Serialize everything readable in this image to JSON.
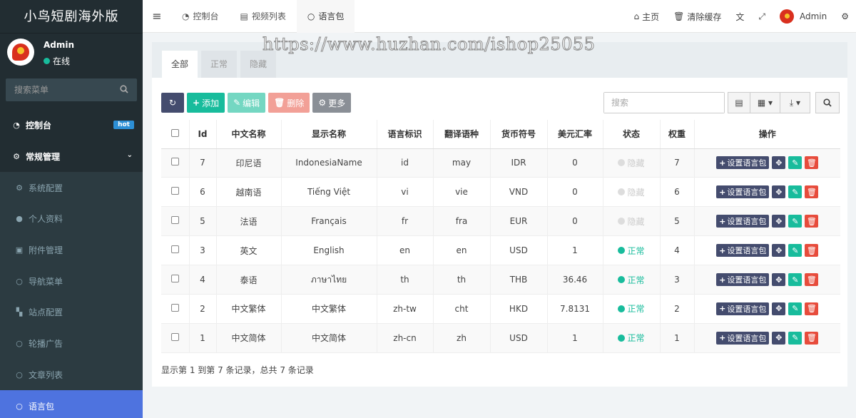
{
  "brand": "小鸟短剧海外版",
  "user": {
    "name": "Admin",
    "status": "在线"
  },
  "sidebar": {
    "search_placeholder": "搜索菜单",
    "items": [
      {
        "label": "控制台",
        "icon": "dashboard-icon",
        "badge": "hot"
      },
      {
        "label": "常规管理",
        "icon": "cogs-icon"
      },
      {
        "label": "系统配置",
        "icon": "gear-icon"
      },
      {
        "label": "个人资料",
        "icon": "user-icon"
      },
      {
        "label": "附件管理",
        "icon": "image-icon"
      },
      {
        "label": "导航菜单",
        "icon": "circle-icon"
      },
      {
        "label": "站点配置",
        "icon": "cubes-icon"
      },
      {
        "label": "轮播广告",
        "icon": "circle-icon"
      },
      {
        "label": "文章列表",
        "icon": "circle-icon"
      },
      {
        "label": "语言包",
        "icon": "circle-icon"
      }
    ]
  },
  "topnav": {
    "tabs": [
      {
        "label": "控制台",
        "icon": "dashboard-icon"
      },
      {
        "label": "视频列表",
        "icon": "file-icon"
      },
      {
        "label": "语言包",
        "icon": "circle-icon"
      }
    ],
    "home_label": "主页",
    "clear_cache_label": "清除缓存",
    "admin_label": "Admin"
  },
  "watermark": "https://www.huzhan.com/ishop25055",
  "filter_tabs": [
    "全部",
    "正常",
    "隐藏"
  ],
  "toolbar": {
    "add_label": "添加",
    "edit_label": "编辑",
    "delete_label": "删除",
    "more_label": "更多",
    "search_placeholder": "搜索"
  },
  "table": {
    "headers": [
      "Id",
      "中文名称",
      "显示名称",
      "语言标识",
      "翻译语种",
      "货币符号",
      "美元汇率",
      "状态",
      "权重",
      "操作"
    ],
    "rows": [
      {
        "id": "7",
        "cn_name": "印尼语",
        "display_name": "IndonesiaName",
        "lang": "id",
        "trans": "may",
        "currency": "IDR",
        "rate": "0",
        "status": "隐藏",
        "status_on": false,
        "weight": "7"
      },
      {
        "id": "6",
        "cn_name": "越南语",
        "display_name": "Tiếng Việt",
        "lang": "vi",
        "trans": "vie",
        "currency": "VND",
        "rate": "0",
        "status": "隐藏",
        "status_on": false,
        "weight": "6"
      },
      {
        "id": "5",
        "cn_name": "法语",
        "display_name": "Français",
        "lang": "fr",
        "trans": "fra",
        "currency": "EUR",
        "rate": "0",
        "status": "隐藏",
        "status_on": false,
        "weight": "5"
      },
      {
        "id": "3",
        "cn_name": "英文",
        "display_name": "English",
        "lang": "en",
        "trans": "en",
        "currency": "USD",
        "rate": "1",
        "status": "正常",
        "status_on": true,
        "weight": "4"
      },
      {
        "id": "4",
        "cn_name": "泰语",
        "display_name": "ภาษาไทย",
        "lang": "th",
        "trans": "th",
        "currency": "THB",
        "rate": "36.46",
        "status": "正常",
        "status_on": true,
        "weight": "3"
      },
      {
        "id": "2",
        "cn_name": "中文繁体",
        "display_name": "中文繁体",
        "lang": "zh-tw",
        "trans": "cht",
        "currency": "HKD",
        "rate": "7.8131",
        "status": "正常",
        "status_on": true,
        "weight": "2"
      },
      {
        "id": "1",
        "cn_name": "中文简体",
        "display_name": "中文简体",
        "lang": "zh-cn",
        "trans": "zh",
        "currency": "USD",
        "rate": "1",
        "status": "正常",
        "status_on": true,
        "weight": "1"
      }
    ],
    "row_action_label": "设置语言包"
  },
  "footer": "显示第 1 到第 7 条记录，总共 7 条记录",
  "colors": {
    "sidebar_bg": "#222d32",
    "active_menu": "#4e73df",
    "success": "#18bc9c",
    "danger": "#e74c3c",
    "dark_button": "#444c6e"
  }
}
